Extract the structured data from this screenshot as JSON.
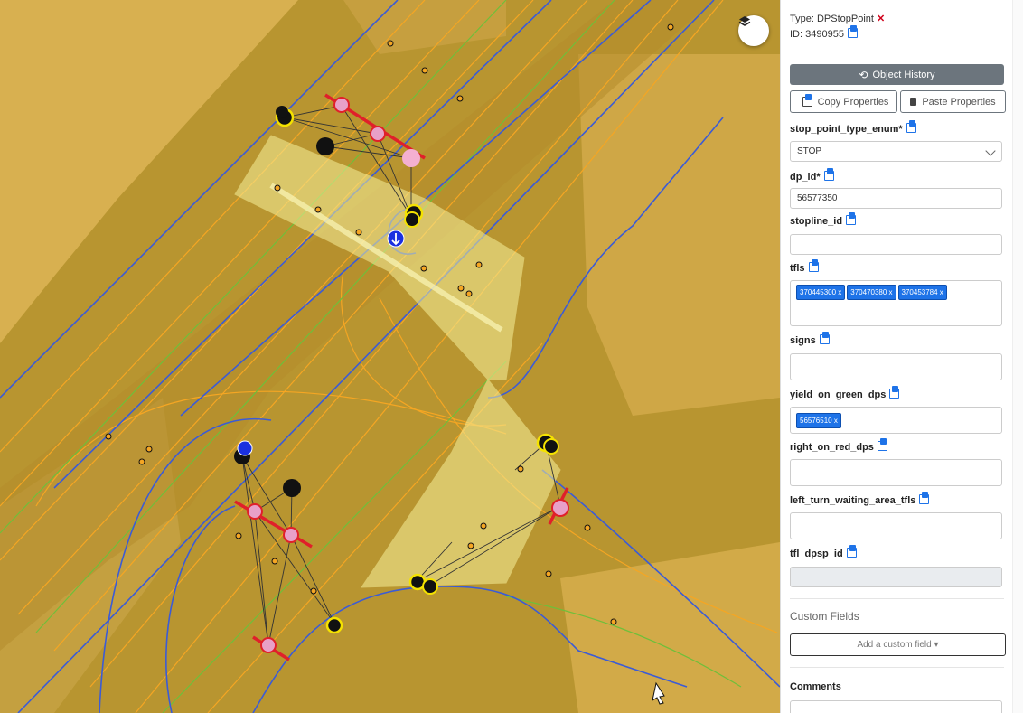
{
  "panel": {
    "type_label": "Type: DPStopPoint",
    "id_label": "ID: 3490955",
    "object_history": "Object History",
    "copy_properties": "Copy Properties",
    "paste_properties": "Paste Properties",
    "fields": {
      "stop_point_type_enum": {
        "label": "stop_point_type_enum*",
        "value": "STOP"
      },
      "dp_id": {
        "label": "dp_id*",
        "value": "56577350"
      },
      "stopline_id": {
        "label": "stopline_id",
        "value": ""
      },
      "tfls": {
        "label": "tfls",
        "chips": [
          "370445300 x",
          "370470380 x",
          "370453784 x"
        ]
      },
      "signs": {
        "label": "signs",
        "value": ""
      },
      "yield_on_green_dps": {
        "label": "yield_on_green_dps",
        "chips": [
          "56576510 x"
        ]
      },
      "right_on_red_dps": {
        "label": "right_on_red_dps",
        "value": ""
      },
      "left_turn_waiting_area_tfls": {
        "label": "left_turn_waiting_area_tfls",
        "value": ""
      },
      "tfl_dpsp_id": {
        "label": "tfl_dpsp_id",
        "value": ""
      }
    },
    "custom_fields_title": "Custom Fields",
    "add_custom_field": "Add a custom field ▾",
    "comments_title": "Comments"
  },
  "map": {
    "layers_icon": "layers-icon",
    "colors": {
      "lane_blue": "#3b5bd6",
      "lane_orange": "#f5a623",
      "lane_green": "#6fbf3a",
      "polygon": "#f6f09a",
      "red": "#e0202a",
      "pink": "#e8a0c8"
    }
  }
}
